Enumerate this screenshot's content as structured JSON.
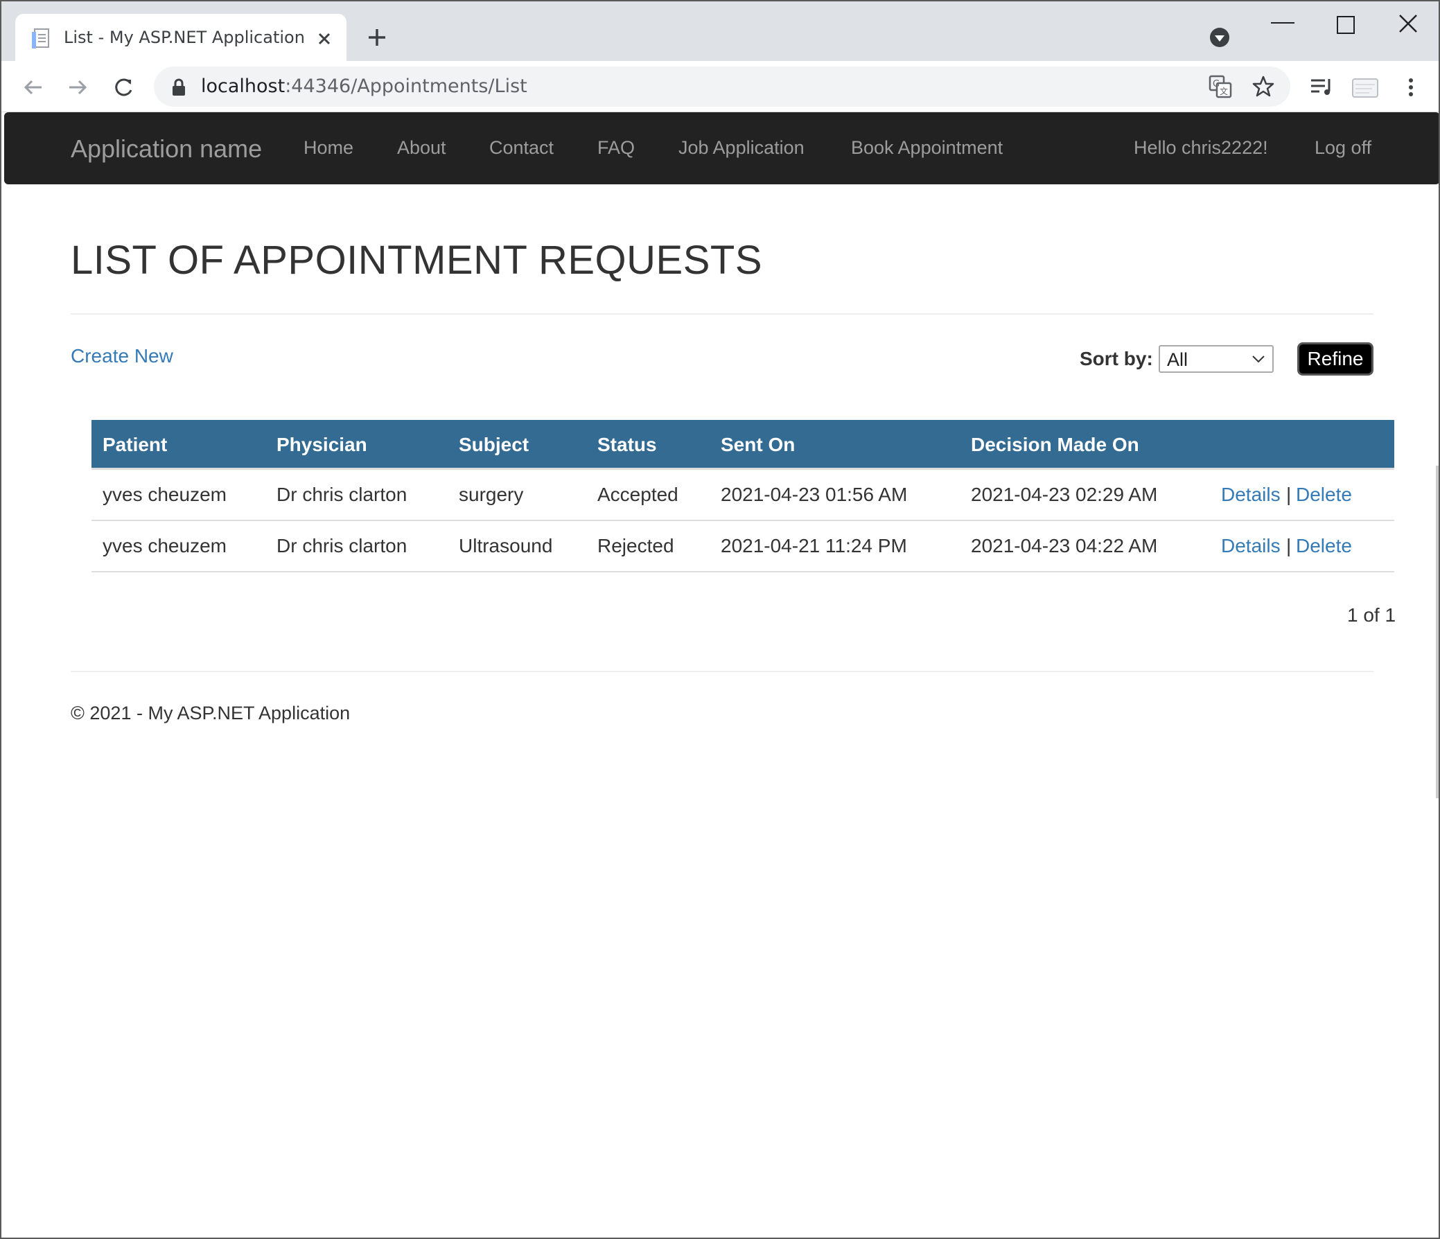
{
  "browser": {
    "tab_title": "List - My ASP.NET Application",
    "url_host": "localhost",
    "url_path": ":44346/Appointments/List"
  },
  "navbar": {
    "brand": "Application name",
    "links": [
      "Home",
      "About",
      "Contact",
      "FAQ",
      "Job Application",
      "Book Appointment"
    ],
    "greeting": "Hello chris2222!",
    "logoff": "Log off"
  },
  "main": {
    "title": "LIST OF APPOINTMENT REQUESTS",
    "create_new": "Create New",
    "sort_label": "Sort by:",
    "sort_value": "All",
    "refine_label": "Refine"
  },
  "table": {
    "headers": [
      "Patient",
      "Physician",
      "Subject",
      "Status",
      "Sent On",
      "Decision Made On"
    ],
    "rows": [
      {
        "patient": "yves cheuzem",
        "physician": "Dr chris clarton",
        "subject": "surgery",
        "status": "Accepted",
        "sent_on": "2021-04-23 01:56 AM",
        "decision_on": "2021-04-23 02:29 AM",
        "details": "Details",
        "separator": "|",
        "delete": "Delete"
      },
      {
        "patient": "yves cheuzem",
        "physician": "Dr chris clarton",
        "subject": "Ultrasound",
        "status": "Rejected",
        "sent_on": "2021-04-21 11:24 PM",
        "decision_on": "2021-04-23 04:22 AM",
        "details": "Details",
        "separator": "|",
        "delete": "Delete"
      }
    ]
  },
  "pager": "1 of 1",
  "footer": "© 2021 - My ASP.NET Application",
  "colors": {
    "navbar_bg": "#222222",
    "table_header_bg": "#336b93",
    "link": "#337ab7"
  }
}
